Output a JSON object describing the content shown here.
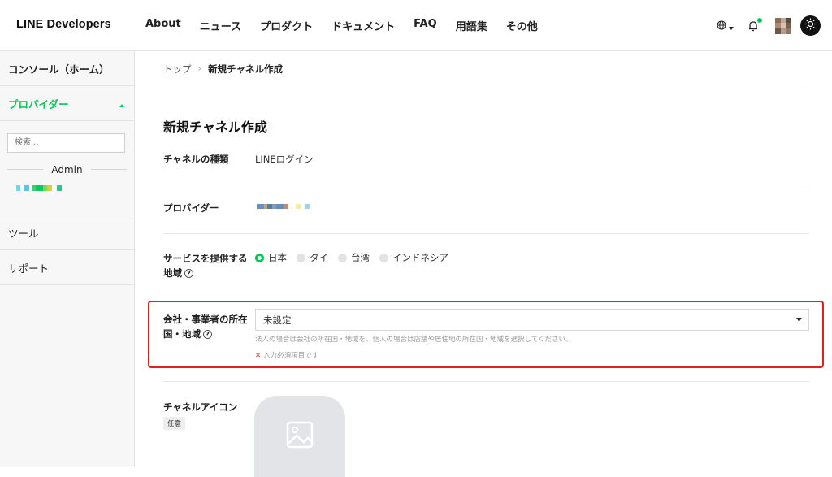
{
  "header": {
    "logo": "LINE Developers",
    "nav": [
      "About",
      "ニュース",
      "プロダクト",
      "ドキュメント",
      "FAQ",
      "用語集",
      "その他"
    ]
  },
  "sidebar": {
    "console": "コンソール（ホーム）",
    "provider": "プロバイダー",
    "search_placeholder": "検索...",
    "admin": "Admin",
    "tools": "ツール",
    "support": "サポート"
  },
  "breadcrumb": {
    "top": "トップ",
    "separator": "›",
    "current": "新規チャネル作成"
  },
  "page_title": "新規チャネル作成",
  "form": {
    "channel_type_label": "チャネルの種類",
    "channel_type_value": "LINEログイン",
    "provider_label": "プロバイダー",
    "region_label_1": "サービスを提供する",
    "region_label_2": "地域",
    "regions": [
      "日本",
      "タイ",
      "台湾",
      "インドネシア"
    ],
    "selected_region": "日本",
    "country_label_1": "会社・事業者の所在",
    "country_label_2": "国・地域",
    "country_value": "未設定",
    "country_hint": "法人の場合は会社の所在国・地域を、個人の場合は店舗や居住地の所在国・地域を選択してください。",
    "country_error": "入力必須項目です",
    "icon_label": "チャネルアイコン",
    "icon_optional": "任意"
  },
  "colors": {
    "accent": "#06c755",
    "highlight": "#e0201f"
  },
  "icons": [
    "globe-icon",
    "bell-icon",
    "sun-icon",
    "chevron-down-icon",
    "image-placeholder-icon",
    "help-icon"
  ]
}
